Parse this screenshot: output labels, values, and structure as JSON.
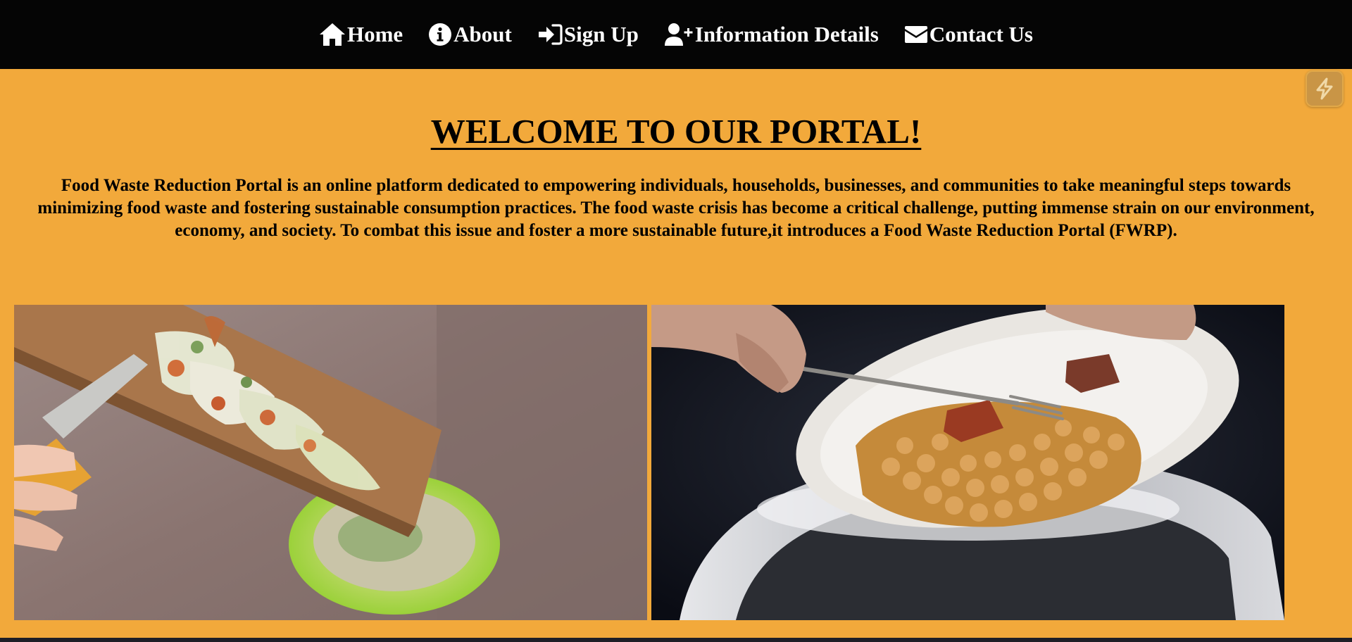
{
  "nav": {
    "items": [
      {
        "label": "Home",
        "icon": "home-icon"
      },
      {
        "label": "About",
        "icon": "info-circle-icon"
      },
      {
        "label": "Sign Up",
        "icon": "sign-in-icon"
      },
      {
        "label": "Information Details",
        "icon": "user-plus-icon"
      },
      {
        "label": "Contact Us",
        "icon": "envelope-icon"
      }
    ]
  },
  "main": {
    "title": "WELCOME TO OUR PORTAL!",
    "intro": "Food Waste Reduction Portal is an online platform dedicated to empowering individuals, households, businesses, and communities to take meaningful steps towards minimizing food waste and fostering sustainable consumption practices. The food waste crisis has become a critical challenge, putting immense strain on our environment, economy, and society. To combat this issue and foster a more sustainable future,it introduces a Food Waste Reduction Portal (FWRP)."
  },
  "colors": {
    "nav_background": "#050505",
    "page_background": "#f2a93b",
    "text": "#000000",
    "nav_text": "#ffffff"
  },
  "widget": {
    "icon": "lightning-icon"
  }
}
